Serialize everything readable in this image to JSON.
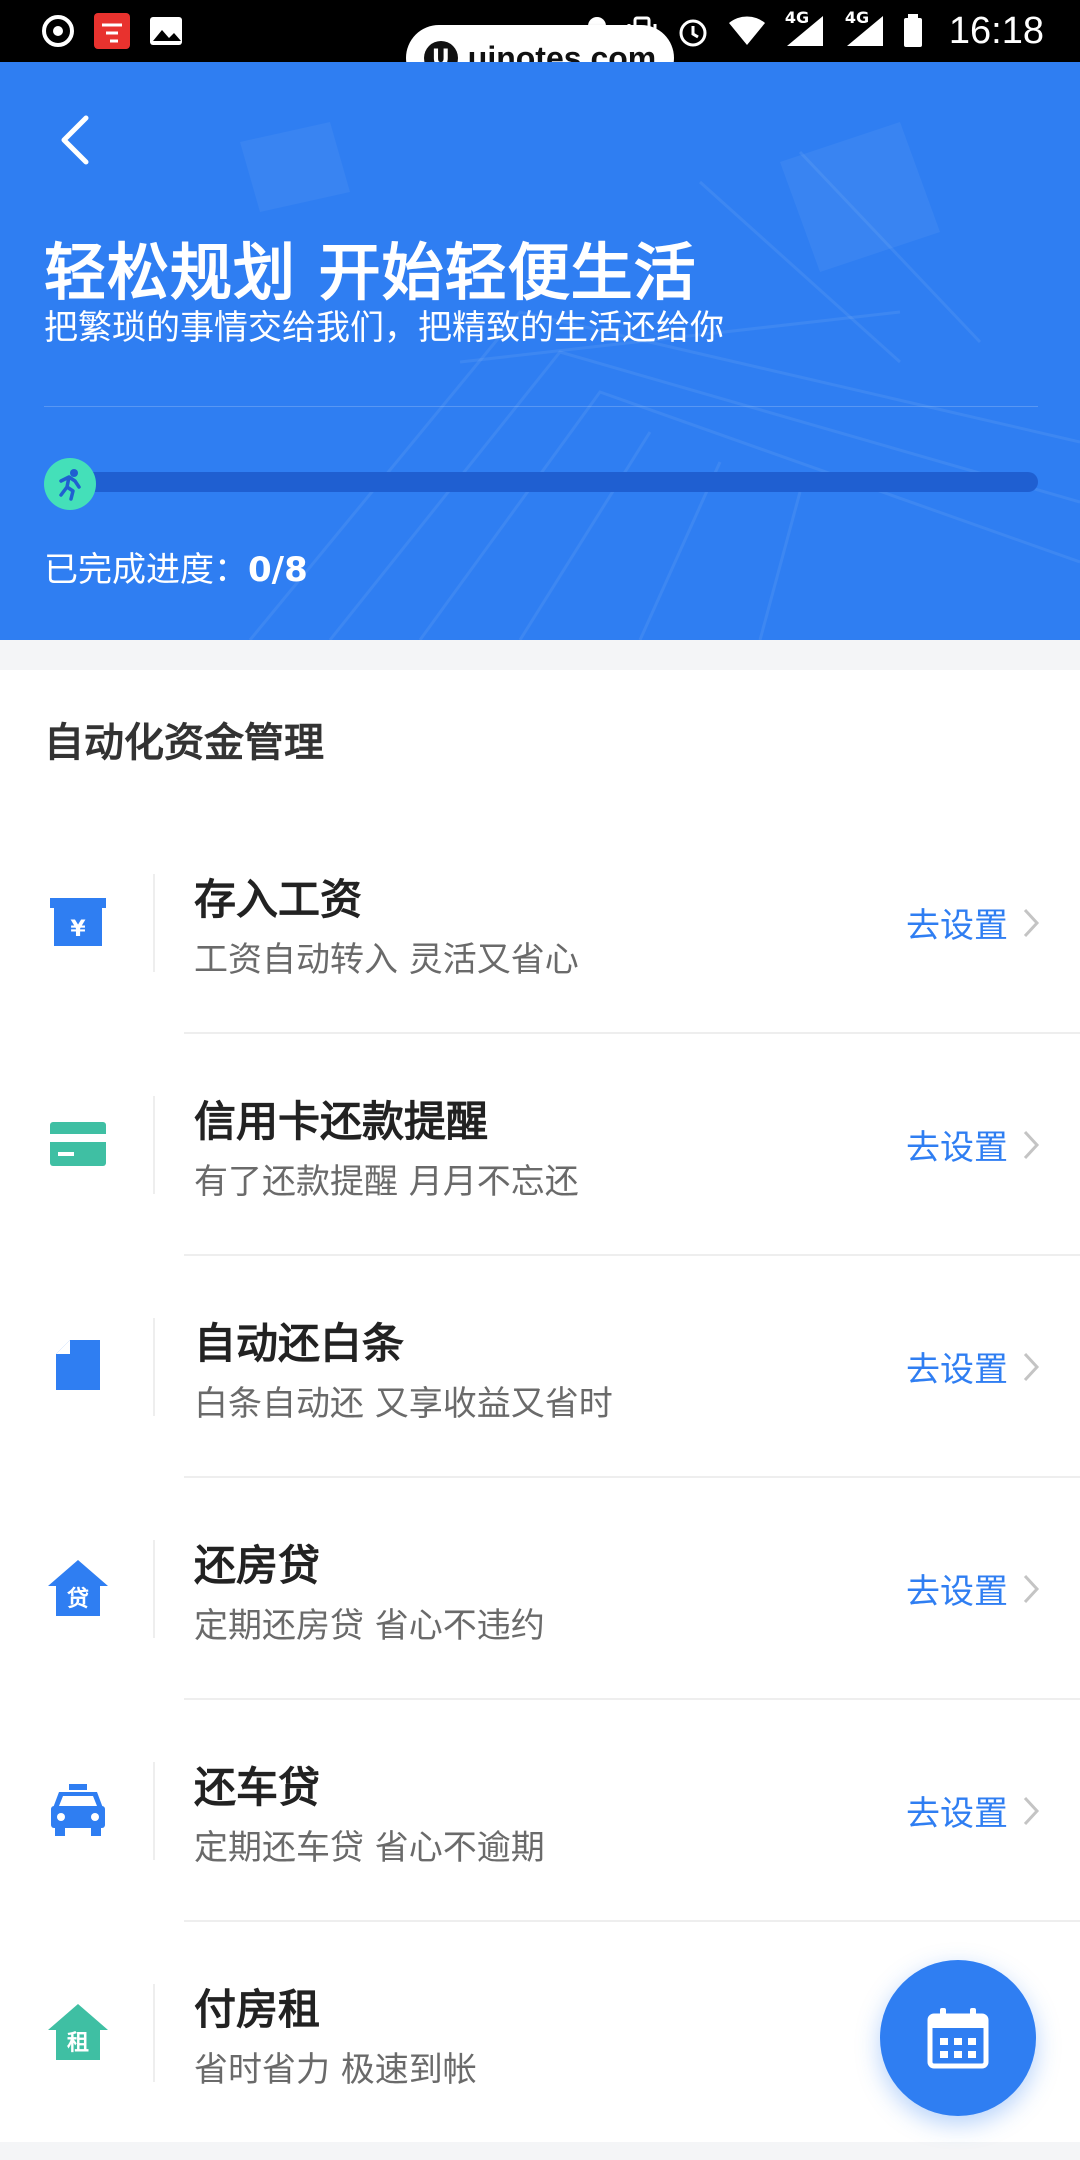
{
  "status_bar": {
    "time": "16:18",
    "network_1": "4G",
    "network_2": "4G"
  },
  "watermark": {
    "logo_letter": "U",
    "text": "uinotes.com"
  },
  "header": {
    "title": "轻松规划 开始轻便生活",
    "subtitle": "把繁琐的事情交给我们，把精致的生活还给你",
    "progress_label": "已完成进度：",
    "progress_value": "0/8",
    "progress_completed": 0,
    "progress_total": 8
  },
  "section": {
    "title": "自动化资金管理"
  },
  "items": [
    {
      "icon": "salary-deposit-icon",
      "title": "存入工资",
      "desc": "工资自动转入 灵活又省心",
      "action": "去设置"
    },
    {
      "icon": "credit-card-icon",
      "title": "信用卡还款提醒",
      "desc": "有了还款提醒 月月不忘还",
      "action": "去设置"
    },
    {
      "icon": "document-icon",
      "title": "自动还白条",
      "desc": "白条自动还 又享收益又省时",
      "action": "去设置"
    },
    {
      "icon": "house-loan-icon",
      "title": "还房贷",
      "desc": "定期还房贷 省心不违约",
      "action": "去设置",
      "badge": "贷"
    },
    {
      "icon": "car-icon",
      "title": "还车贷",
      "desc": "定期还车贷 省心不逾期",
      "action": "去设置"
    },
    {
      "icon": "house-rent-icon",
      "title": "付房租",
      "desc": "省时省力 极速到帐",
      "action": "",
      "badge": "租"
    }
  ],
  "colors": {
    "primary": "#2f7ef2",
    "progress_accent": "#44e0b9",
    "rent_icon": "#3fbfa3",
    "card_icon": "#3fbfa3"
  }
}
